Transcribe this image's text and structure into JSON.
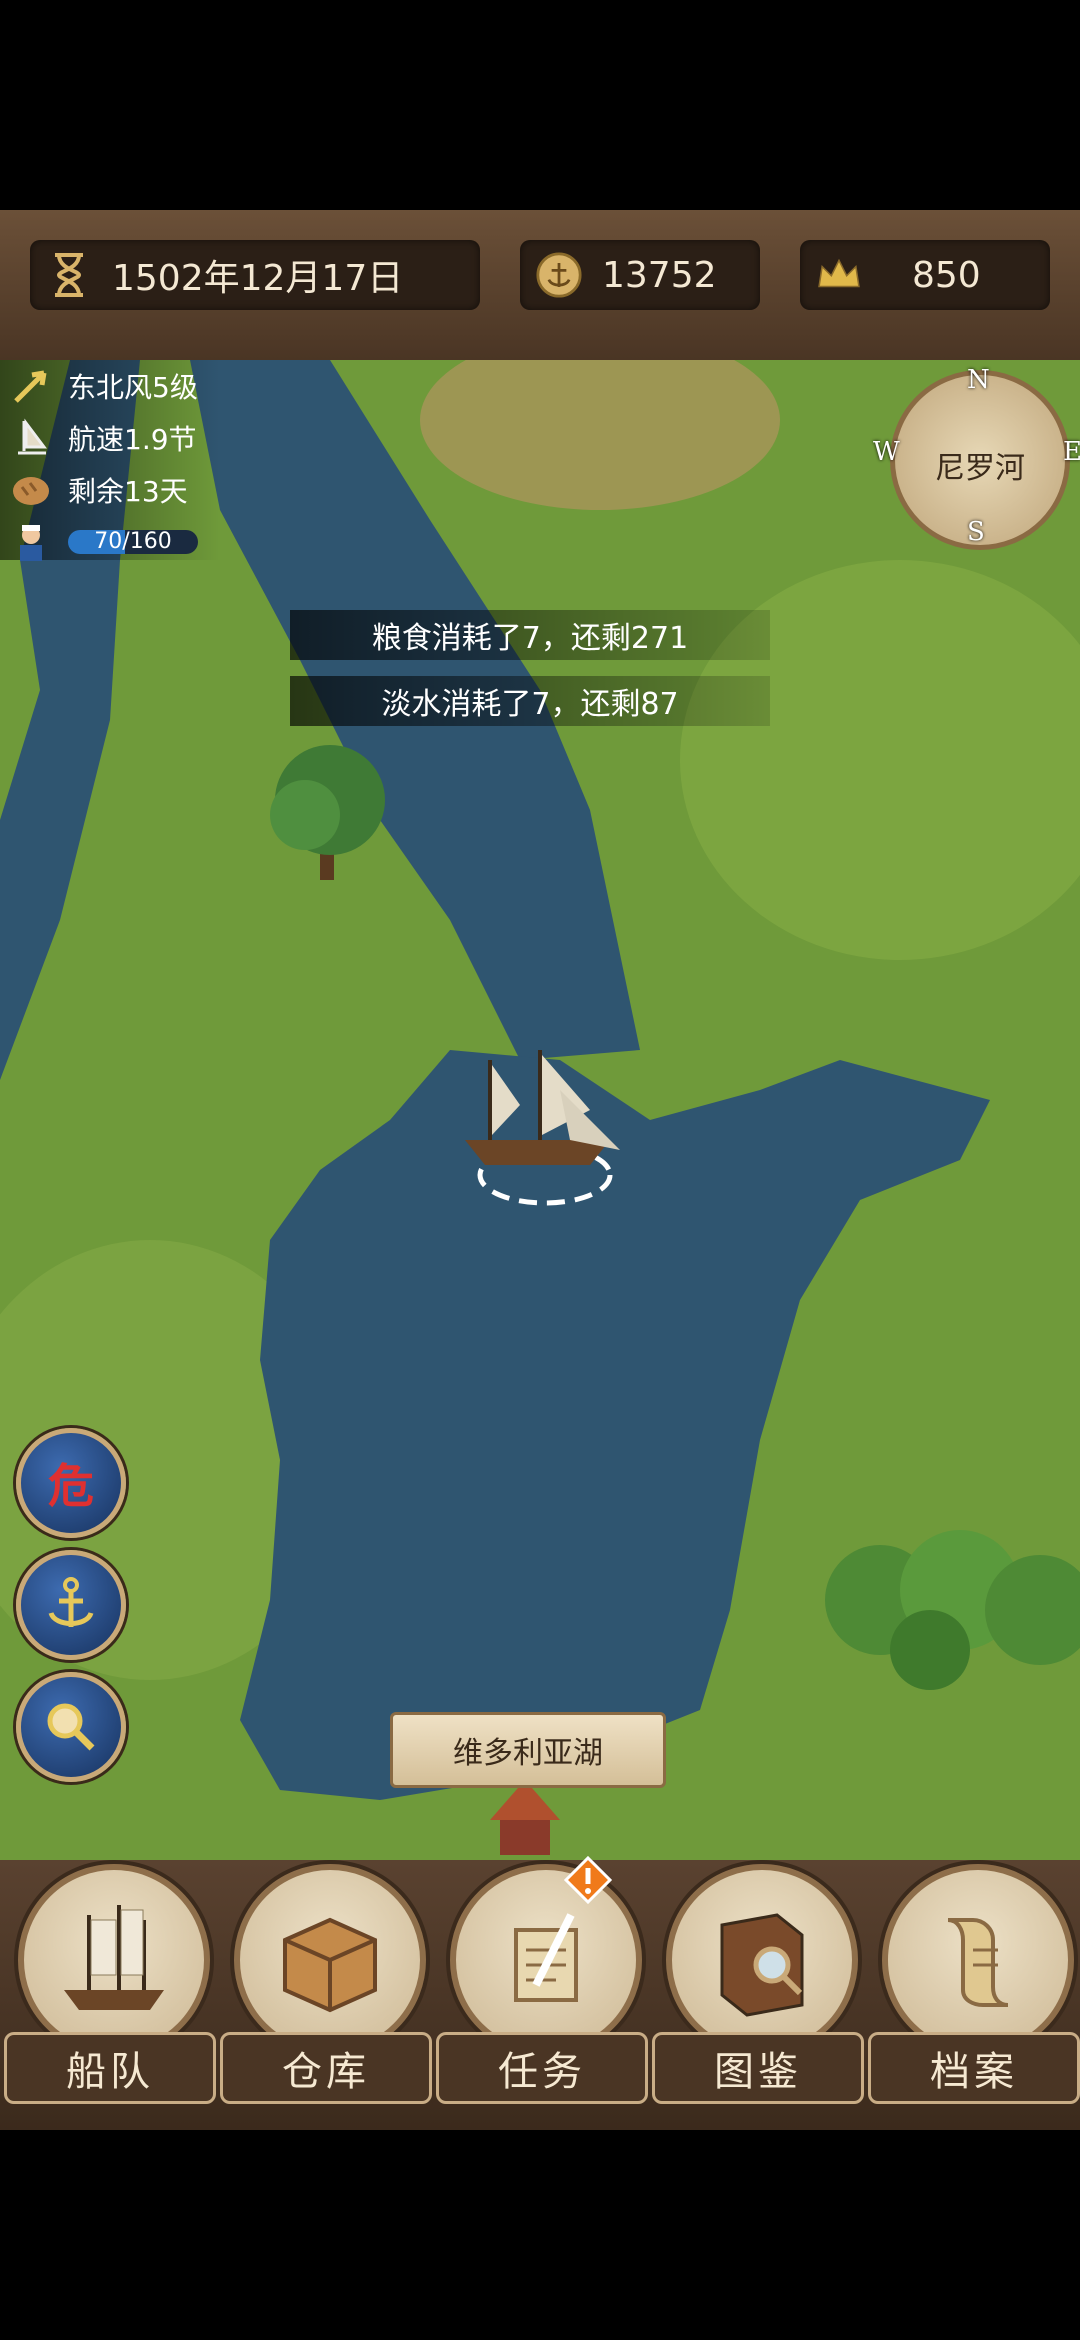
{
  "topbar": {
    "date": "1502年12月17日",
    "gold": "13752",
    "fame": "850"
  },
  "status": {
    "wind": "东北风5级",
    "speed": "航速1.9节",
    "days_left": "剩余13天",
    "crew": "70/160",
    "crew_fraction": 0.4375
  },
  "messages": [
    "粮食消耗了7，还剩271",
    "淡水消耗了7，还剩87"
  ],
  "compass": {
    "location": "尼罗河",
    "n": "N",
    "s": "S",
    "w": "W",
    "e": "E"
  },
  "map": {
    "lake_label": "维多利亚湖"
  },
  "side_buttons": {
    "danger_label": "危"
  },
  "nav": {
    "items": [
      {
        "label": "船队",
        "icon": "ship-icon"
      },
      {
        "label": "仓库",
        "icon": "crate-icon"
      },
      {
        "label": "任务",
        "icon": "scroll-quill-icon"
      },
      {
        "label": "图鉴",
        "icon": "book-magnifier-icon"
      },
      {
        "label": "档案",
        "icon": "rolled-map-icon"
      }
    ]
  },
  "colors": {
    "water": "#2f5570",
    "land": "#6f9a3a",
    "wood": "#4a3524"
  }
}
